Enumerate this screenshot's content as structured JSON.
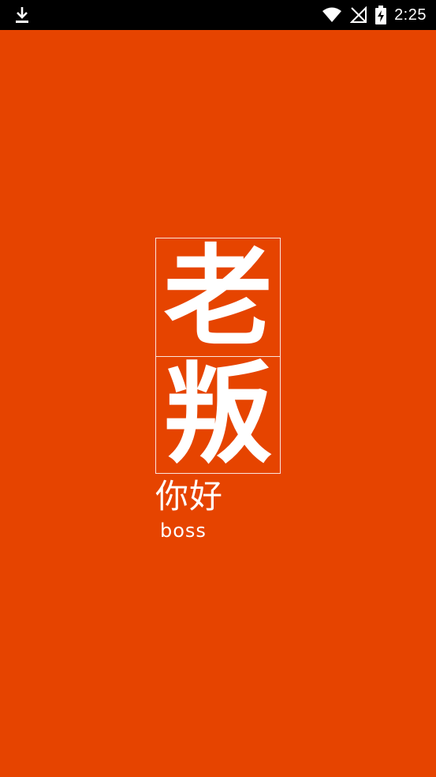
{
  "status_bar": {
    "time": "2:25",
    "icons": [
      "download-icon",
      "wifi-icon",
      "no-signal-icon",
      "battery-charging-icon"
    ]
  },
  "splash": {
    "logo_top_char": "老",
    "logo_bottom_char": "叛",
    "tagline_cn": "你好",
    "tagline_en": "boss"
  },
  "colors": {
    "background": "#e64400",
    "status_bar": "#000000",
    "foreground": "#ffffff"
  }
}
